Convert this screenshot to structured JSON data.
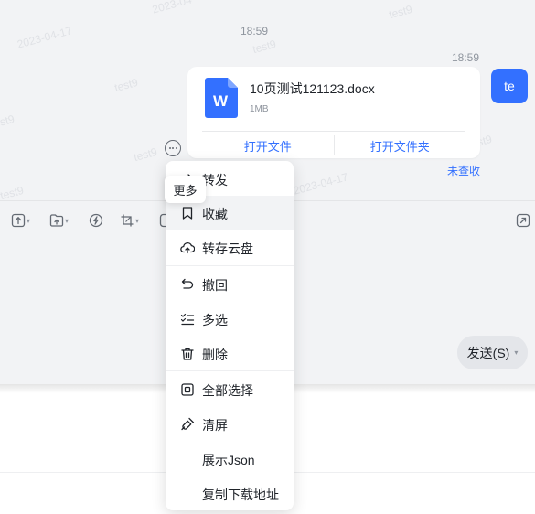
{
  "watermark": {
    "texts": [
      "2023-04",
      "test9",
      "2023-04-17",
      "test9",
      "test9",
      "test9",
      "test9",
      "2023-04-17",
      "test9",
      "test9"
    ]
  },
  "conversation": {
    "time1": "18:59",
    "time2": "18:59",
    "avatar_text": "te",
    "file_card": {
      "icon": "word-document-icon",
      "icon_letter": "W",
      "file_name": "10页测试121123.docx",
      "file_size": "1MB",
      "open_file": "打开文件",
      "open_folder": "打开文件夹"
    },
    "read_status": "未查收"
  },
  "more_tooltip": "更多",
  "toolbar": {
    "icons": [
      "upload-icon",
      "folder-upload-icon",
      "lightning-icon",
      "crop-screenshot-icon",
      "emoji-icon",
      "expand-icon"
    ]
  },
  "send_button": {
    "label": "发送(S)"
  },
  "context_menu": {
    "items": [
      {
        "label": "转发",
        "icon": "forward-icon"
      },
      {
        "label": "收藏",
        "icon": "bookmark-icon"
      },
      {
        "label": "转存云盘",
        "icon": "cloud-upload-icon"
      },
      {
        "label": "撤回",
        "icon": "undo-icon"
      },
      {
        "label": "多选",
        "icon": "checklist-icon"
      },
      {
        "label": "删除",
        "icon": "trash-icon"
      },
      {
        "label": "全部选择",
        "icon": "select-all-icon"
      },
      {
        "label": "清屏",
        "icon": "broom-icon"
      },
      {
        "label": "展示Json",
        "icon": ""
      },
      {
        "label": "复制下载地址",
        "icon": ""
      }
    ]
  },
  "colors": {
    "accent": "#3370ff",
    "chat_bg": "#f2f3f5",
    "menu_hover": "#f2f3f5"
  }
}
